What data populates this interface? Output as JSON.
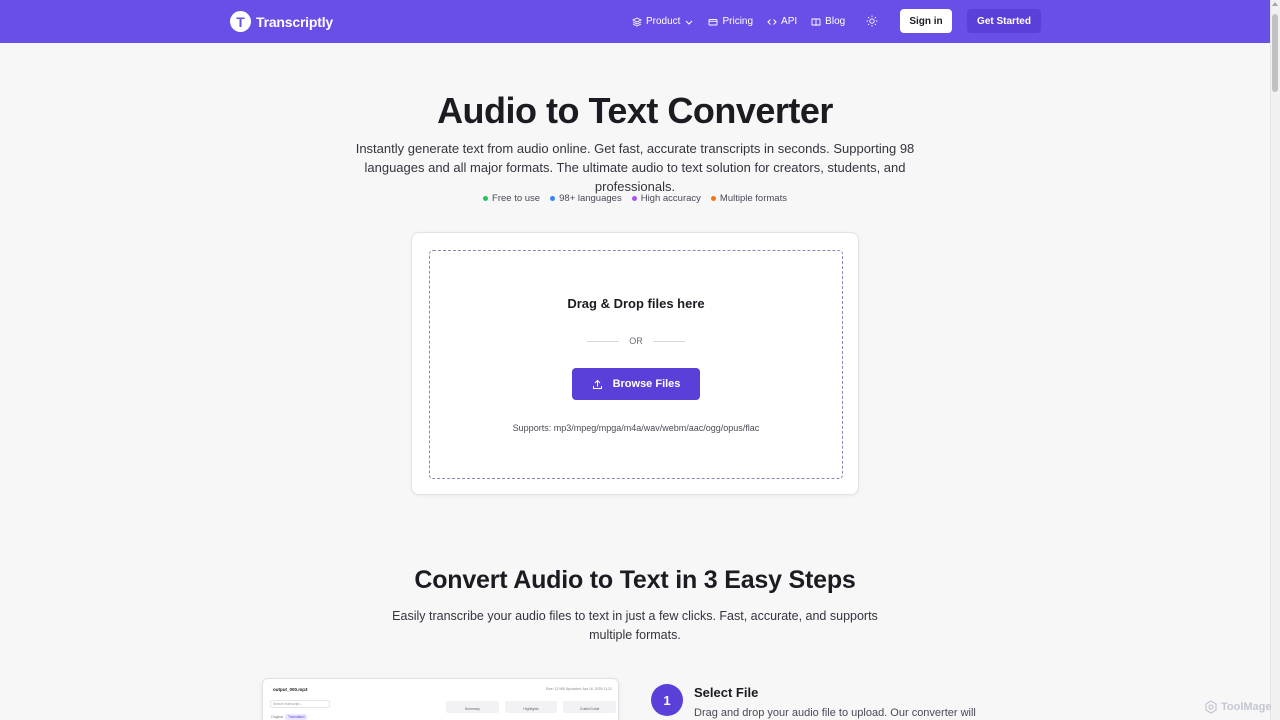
{
  "nav": {
    "brand_initial": "T",
    "brand": "Transcriptly",
    "links": [
      "Product",
      "Pricing",
      "API",
      "Blog"
    ],
    "sign_in": "Sign in",
    "get_started": "Get Started"
  },
  "hero": {
    "title": "Audio to Text Converter",
    "subtitle": "Instantly generate text from audio online. Get fast, accurate transcripts in seconds. Supporting 98 languages and all major formats. The ultimate audio to text solution for creators, students, and professionals.",
    "features": [
      {
        "label": "Free to use",
        "color": "#22c55e"
      },
      {
        "label": "98+ languages",
        "color": "#3b82f6"
      },
      {
        "label": "High accuracy",
        "color": "#a855f7"
      },
      {
        "label": "Multiple formats",
        "color": "#f97316"
      }
    ]
  },
  "upload": {
    "title": "Drag & Drop files here",
    "or": "OR",
    "browse": "Browse Files",
    "supports": "Supports: mp3/mpeg/mpga/m4a/wav/webm/aac/ogg/opus/flac"
  },
  "steps": {
    "title": "Convert Audio to Text in 3 Easy Steps",
    "subtitle": "Easily transcribe your audio files to text in just a few clicks. Fast, accurate, and supports multiple formats.",
    "step1": {
      "number": "1",
      "title": "Select File",
      "desc": "Drag and drop your audio file to upload. Our converter will"
    }
  },
  "preview": {
    "file": "output_000.mp3",
    "meta": "Size: 12 MB  Uploaded: Apr 16, 2025 11:21",
    "search": "Search transcript...",
    "tabs": [
      "Summary",
      "Highlights",
      "Guide/Guide"
    ],
    "chip1": "Original",
    "chip2": "Translated"
  },
  "watermark": "ToolMage",
  "colors": {
    "primary": "#6a4ee8",
    "button": "#5b3fd9"
  }
}
